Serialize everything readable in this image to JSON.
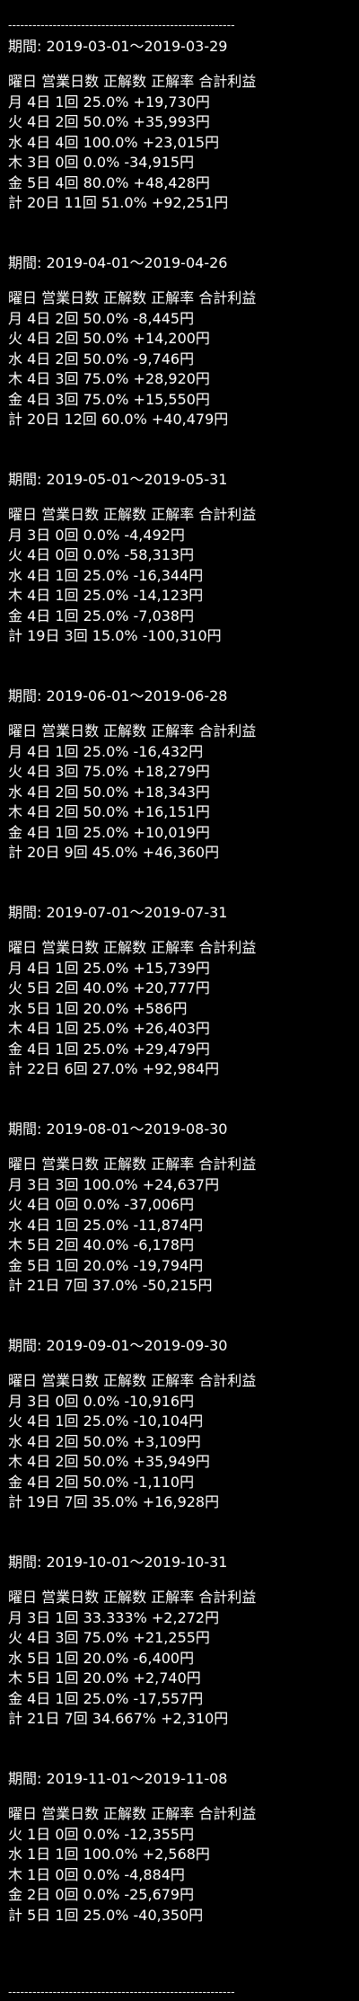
{
  "divider": "--------------------------------------------------------",
  "header": "曜日 営業日数 正解数 正解率 合計利益",
  "periods": [
    {
      "title": "期間: 2019-03-01〜2019-03-29",
      "rows": [
        "月 4日 1回 25.0% +19,730円",
        "火 4日 2回 50.0% +35,993円",
        "水 4日 4回 100.0% +23,015円",
        "木 3日 0回 0.0% -34,915円",
        "金 5日 4回 80.0% +48,428円",
        "計 20日 11回 51.0% +92,251円"
      ]
    },
    {
      "title": "期間: 2019-04-01〜2019-04-26",
      "rows": [
        "月 4日 2回 50.0% -8,445円",
        "火 4日 2回 50.0% +14,200円",
        "水 4日 2回 50.0% -9,746円",
        "木 4日 3回 75.0% +28,920円",
        "金 4日 3回 75.0% +15,550円",
        "計 20日 12回 60.0% +40,479円"
      ]
    },
    {
      "title": "期間: 2019-05-01〜2019-05-31",
      "rows": [
        "月 3日 0回 0.0% -4,492円",
        "火 4日 0回 0.0% -58,313円",
        "水 4日 1回 25.0% -16,344円",
        "木 4日 1回 25.0% -14,123円",
        "金 4日 1回 25.0% -7,038円",
        "計 19日 3回 15.0% -100,310円"
      ]
    },
    {
      "title": "期間: 2019-06-01〜2019-06-28",
      "rows": [
        "月 4日 1回 25.0% -16,432円",
        "火 4日 3回 75.0% +18,279円",
        "水 4日 2回 50.0% +18,343円",
        "木 4日 2回 50.0% +16,151円",
        "金 4日 1回 25.0% +10,019円",
        "計 20日 9回 45.0% +46,360円"
      ]
    },
    {
      "title": "期間: 2019-07-01〜2019-07-31",
      "rows": [
        "月 4日 1回 25.0% +15,739円",
        "火 5日 2回 40.0% +20,777円",
        "水 5日 1回 20.0% +586円",
        "木 4日 1回 25.0% +26,403円",
        "金 4日 1回 25.0% +29,479円",
        "計 22日 6回 27.0% +92,984円"
      ]
    },
    {
      "title": "期間: 2019-08-01〜2019-08-30",
      "rows": [
        "月 3日 3回 100.0% +24,637円",
        "火 4日 0回 0.0% -37,006円",
        "水 4日 1回 25.0% -11,874円",
        "木 5日 2回 40.0% -6,178円",
        "金 5日 1回 20.0% -19,794円",
        "計 21日 7回 37.0% -50,215円"
      ]
    },
    {
      "title": "期間: 2019-09-01〜2019-09-30",
      "rows": [
        "月 3日 0回 0.0% -10,916円",
        "火 4日 1回 25.0% -10,104円",
        "水 4日 2回 50.0% +3,109円",
        "木 4日 2回 50.0% +35,949円",
        "金 4日 2回 50.0% -1,110円",
        "計 19日 7回 35.0% +16,928円"
      ]
    },
    {
      "title": "期間: 2019-10-01〜2019-10-31",
      "rows": [
        "月 3日 1回 33.333% +2,272円",
        "火 4日 3回 75.0% +21,255円",
        "水 5日 1回 20.0% -6,400円",
        "木 5日 1回 20.0% +2,740円",
        "金 4日 1回 25.0% -17,557円",
        "計 21日 7回 34.667% +2,310円"
      ]
    },
    {
      "title": "期間: 2019-11-01〜2019-11-08",
      "rows": [
        "火 1日 0回 0.0% -12,355円",
        "水 1日 1回 100.0% +2,568円",
        "木 1日 0回 0.0% -4,884円",
        "金 2日 0回 0.0% -25,679円",
        "計 5日 1回 25.0% -40,350円"
      ]
    }
  ]
}
